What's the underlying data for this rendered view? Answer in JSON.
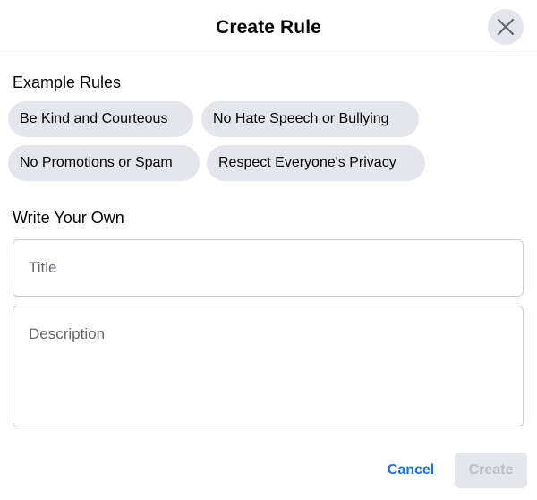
{
  "dialog": {
    "title": "Create Rule",
    "close_icon": "close-icon"
  },
  "examples": {
    "label": "Example Rules",
    "chips": [
      {
        "label": "Be Kind and Courteous"
      },
      {
        "label": "No Hate Speech or Bullying"
      },
      {
        "label": "No Promotions or Spam"
      },
      {
        "label": "Respect Everyone's Privacy"
      }
    ]
  },
  "own": {
    "label": "Write Your Own",
    "title_field": {
      "value": "",
      "placeholder": "Title"
    },
    "description_field": {
      "value": "",
      "placeholder": "Description"
    }
  },
  "footer": {
    "cancel_label": "Cancel",
    "create_label": "Create",
    "create_enabled": false
  },
  "colors": {
    "accent": "#1b74e4",
    "chip_bg": "#e4e6eb",
    "disabled_text": "#bcc0c4",
    "placeholder": "#65676b"
  }
}
